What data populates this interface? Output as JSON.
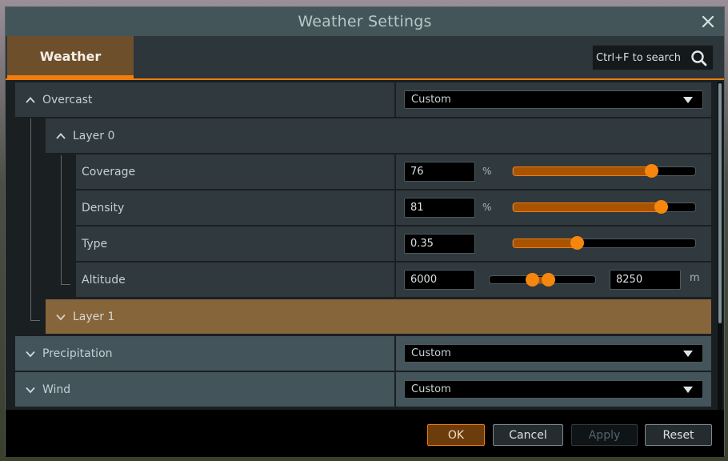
{
  "window": {
    "title": "Weather Settings",
    "close_icon": "close-icon"
  },
  "tabs": [
    {
      "label": "Weather",
      "active": true
    }
  ],
  "search": {
    "placeholder": "Ctrl+F to search",
    "value": "",
    "icon": "search-icon"
  },
  "colors": {
    "accent": "#f07d0c",
    "selected_row": "#86653b",
    "active_tab": "#6d4f2c",
    "panel": "#30393d",
    "titlebar": "#445559"
  },
  "tree": {
    "overcast": {
      "label": "Overcast",
      "expanded": true,
      "preset": "Custom",
      "layers": [
        {
          "label": "Layer 0",
          "expanded": true,
          "coverage": {
            "label": "Coverage",
            "value": "76",
            "unit": "%",
            "fraction": 0.76
          },
          "density": {
            "label": "Density",
            "value": "81",
            "unit": "%",
            "fraction": 0.81
          },
          "type": {
            "label": "Type",
            "value": "0.35",
            "fraction": 0.35
          },
          "altitude": {
            "label": "Altitude",
            "min_value": "6000",
            "max_value": "8250",
            "unit": "m",
            "range_low_fraction": 0.4,
            "range_high_fraction": 0.55
          }
        },
        {
          "label": "Layer 1",
          "expanded": false,
          "selected": true
        }
      ]
    },
    "precipitation": {
      "label": "Precipitation",
      "expanded": false,
      "preset": "Custom"
    },
    "wind": {
      "label": "Wind",
      "expanded": false,
      "preset": "Custom"
    }
  },
  "footer": {
    "ok_label": "OK",
    "cancel_label": "Cancel",
    "apply_label": "Apply",
    "reset_label": "Reset"
  }
}
